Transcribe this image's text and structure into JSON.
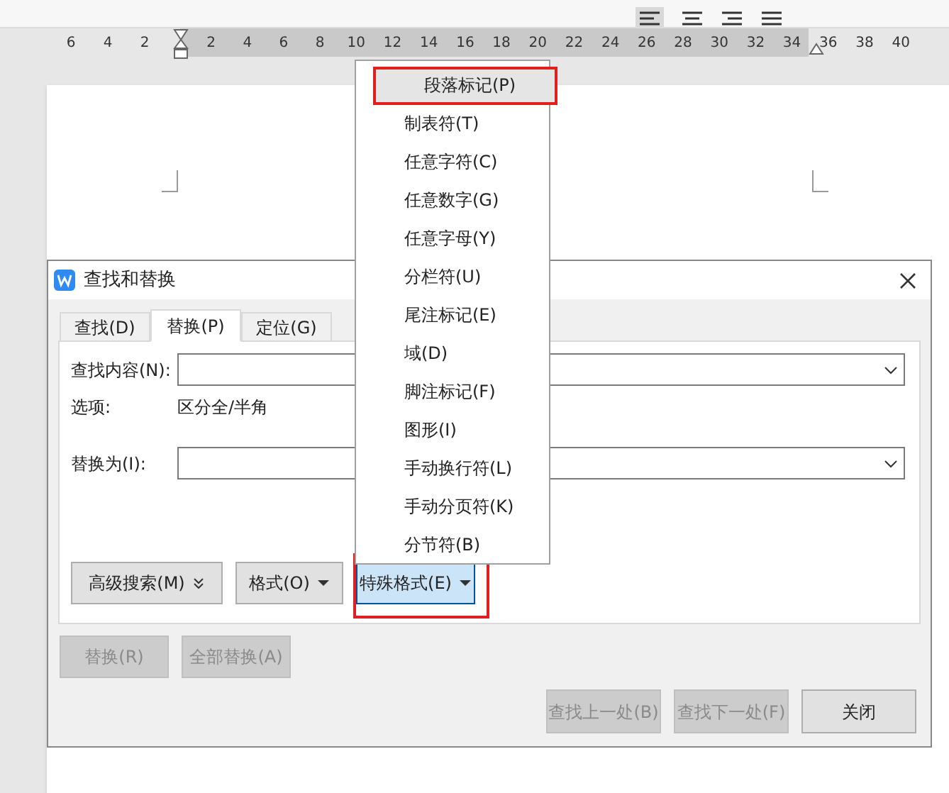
{
  "ruler": {
    "left_ticks": [
      "6",
      "4",
      "2"
    ],
    "right_ticks": [
      "2",
      "4",
      "6",
      "8",
      "10",
      "12",
      "14",
      "16",
      "18",
      "20",
      "22",
      "24",
      "26",
      "28",
      "30",
      "32",
      "34",
      "36",
      "38",
      "40"
    ]
  },
  "dialog": {
    "title": "查找和替换",
    "tabs": [
      {
        "label": "查找(D)",
        "selected": false
      },
      {
        "label": "替换(P)",
        "selected": true
      },
      {
        "label": "定位(G)",
        "selected": false
      }
    ],
    "find_label": "查找内容(N):",
    "options_label": "选项:",
    "options_value": "区分全/半角",
    "replace_label": "替换为(I):",
    "format_buttons": [
      {
        "label": "高级搜索(M)",
        "kind": "expand",
        "active": false,
        "highlighted": false
      },
      {
        "label": "格式(O)",
        "kind": "dropdown",
        "active": false,
        "highlighted": false
      },
      {
        "label": "特殊格式(E)",
        "kind": "dropdown",
        "active": true,
        "highlighted": true
      }
    ],
    "replace_buttons": [
      {
        "label": "替换(R)",
        "disabled": true
      },
      {
        "label": "全部替换(A)",
        "disabled": true
      }
    ],
    "bottom_buttons": [
      {
        "label": "查找上一处(B)",
        "disabled": true
      },
      {
        "label": "查找下一处(F)",
        "disabled": true
      },
      {
        "label": "关闭",
        "disabled": false
      }
    ]
  },
  "menu": {
    "items": [
      {
        "label": "段落标记(P)",
        "selected": true,
        "highlighted": true
      },
      {
        "label": "制表符(T)",
        "selected": false,
        "highlighted": false
      },
      {
        "label": "任意字符(C)",
        "selected": false,
        "highlighted": false
      },
      {
        "label": "任意数字(G)",
        "selected": false,
        "highlighted": false
      },
      {
        "label": "任意字母(Y)",
        "selected": false,
        "highlighted": false
      },
      {
        "label": "分栏符(U)",
        "selected": false,
        "highlighted": false
      },
      {
        "label": "尾注标记(E)",
        "selected": false,
        "highlighted": false
      },
      {
        "label": "域(D)",
        "selected": false,
        "highlighted": false
      },
      {
        "label": "脚注标记(F)",
        "selected": false,
        "highlighted": false
      },
      {
        "label": "图形(I)",
        "selected": false,
        "highlighted": false
      },
      {
        "label": "手动换行符(L)",
        "selected": false,
        "highlighted": false
      },
      {
        "label": "手动分页符(K)",
        "selected": false,
        "highlighted": false
      },
      {
        "label": "分节符(B)",
        "selected": false,
        "highlighted": false
      }
    ]
  }
}
